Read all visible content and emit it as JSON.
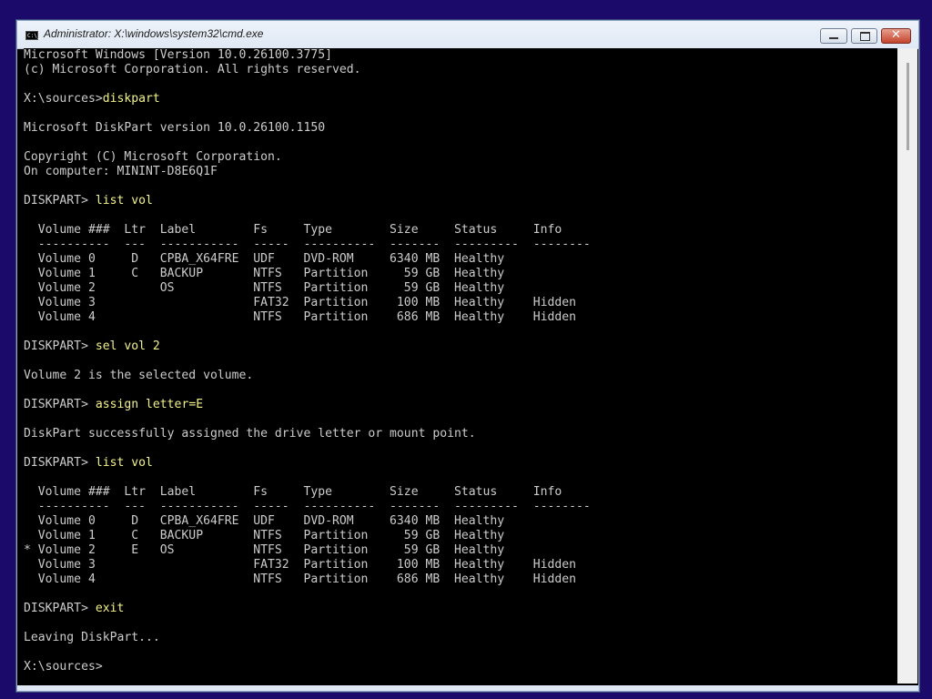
{
  "window": {
    "title": "Administrator: X:\\windows\\system32\\cmd.exe",
    "icon_text": "C:\\_",
    "close_glyph": "✕"
  },
  "console_lines": [
    {
      "pre": "Microsoft Windows [Version 10.0.26100.3775]",
      "cmd": ""
    },
    {
      "pre": "(c) Microsoft Corporation. All rights reserved.",
      "cmd": ""
    },
    {
      "pre": "",
      "cmd": ""
    },
    {
      "pre": "X:\\sources>",
      "cmd": "diskpart"
    },
    {
      "pre": "",
      "cmd": ""
    },
    {
      "pre": "Microsoft DiskPart version 10.0.26100.1150",
      "cmd": ""
    },
    {
      "pre": "",
      "cmd": ""
    },
    {
      "pre": "Copyright (C) Microsoft Corporation.",
      "cmd": ""
    },
    {
      "pre": "On computer: MININT-D8E6Q1F",
      "cmd": ""
    },
    {
      "pre": "",
      "cmd": ""
    },
    {
      "pre": "DISKPART> ",
      "cmd": "list vol"
    },
    {
      "pre": "",
      "cmd": ""
    },
    {
      "pre": "  Volume ###  Ltr  Label        Fs     Type        Size     Status     Info",
      "cmd": ""
    },
    {
      "pre": "  ----------  ---  -----------  -----  ----------  -------  ---------  --------",
      "cmd": ""
    },
    {
      "pre": "  Volume 0     D   CPBA_X64FRE  UDF    DVD-ROM     6340 MB  Healthy",
      "cmd": ""
    },
    {
      "pre": "  Volume 1     C   BACKUP       NTFS   Partition     59 GB  Healthy",
      "cmd": ""
    },
    {
      "pre": "  Volume 2         OS           NTFS   Partition     59 GB  Healthy",
      "cmd": ""
    },
    {
      "pre": "  Volume 3                      FAT32  Partition    100 MB  Healthy    Hidden",
      "cmd": ""
    },
    {
      "pre": "  Volume 4                      NTFS   Partition    686 MB  Healthy    Hidden",
      "cmd": ""
    },
    {
      "pre": "",
      "cmd": ""
    },
    {
      "pre": "DISKPART> ",
      "cmd": "sel vol 2"
    },
    {
      "pre": "",
      "cmd": ""
    },
    {
      "pre": "Volume 2 is the selected volume.",
      "cmd": ""
    },
    {
      "pre": "",
      "cmd": ""
    },
    {
      "pre": "DISKPART> ",
      "cmd": "assign letter=E"
    },
    {
      "pre": "",
      "cmd": ""
    },
    {
      "pre": "DiskPart successfully assigned the drive letter or mount point.",
      "cmd": ""
    },
    {
      "pre": "",
      "cmd": ""
    },
    {
      "pre": "DISKPART> ",
      "cmd": "list vol"
    },
    {
      "pre": "",
      "cmd": ""
    },
    {
      "pre": "  Volume ###  Ltr  Label        Fs     Type        Size     Status     Info",
      "cmd": ""
    },
    {
      "pre": "  ----------  ---  -----------  -----  ----------  -------  ---------  --------",
      "cmd": ""
    },
    {
      "pre": "  Volume 0     D   CPBA_X64FRE  UDF    DVD-ROM     6340 MB  Healthy",
      "cmd": ""
    },
    {
      "pre": "  Volume 1     C   BACKUP       NTFS   Partition     59 GB  Healthy",
      "cmd": ""
    },
    {
      "pre": "* Volume 2     E   OS           NTFS   Partition     59 GB  Healthy",
      "cmd": ""
    },
    {
      "pre": "  Volume 3                      FAT32  Partition    100 MB  Healthy    Hidden",
      "cmd": ""
    },
    {
      "pre": "  Volume 4                      NTFS   Partition    686 MB  Healthy    Hidden",
      "cmd": ""
    },
    {
      "pre": "",
      "cmd": ""
    },
    {
      "pre": "DISKPART> ",
      "cmd": "exit"
    },
    {
      "pre": "",
      "cmd": ""
    },
    {
      "pre": "Leaving DiskPart...",
      "cmd": ""
    },
    {
      "pre": "",
      "cmd": ""
    },
    {
      "pre": "X:\\sources>",
      "cmd": ""
    }
  ],
  "icons": {
    "window_icon": "cmd-icon",
    "minimize": "minimize-icon",
    "maximize": "maximize-icon",
    "close": "close-icon"
  },
  "colors": {
    "desktop": "#1c0a6b",
    "console_bg": "#000000",
    "console_text": "#cccccc",
    "command_text": "#f2f28a"
  }
}
